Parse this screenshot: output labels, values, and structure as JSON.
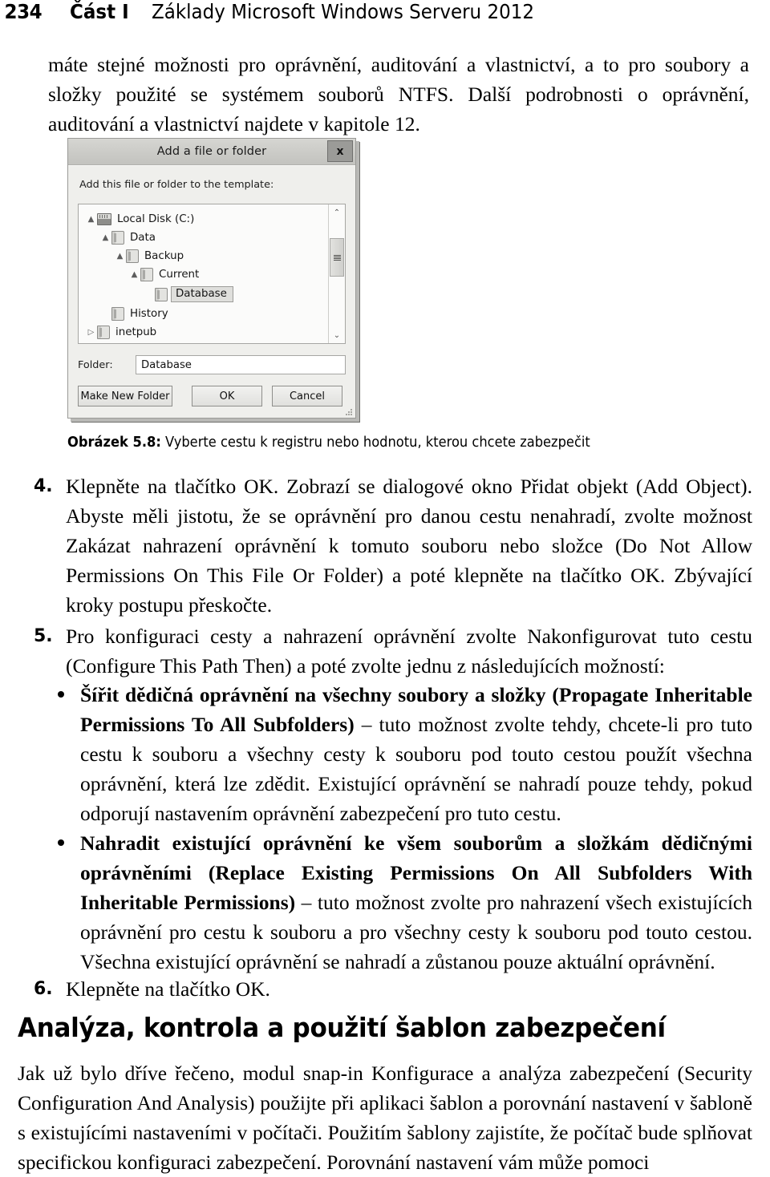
{
  "page": {
    "folio": "234",
    "part": "Část I",
    "book_title": "Základy Microsoft Windows Serveru 2012"
  },
  "intro_paragraph": "máte stejné možnosti pro oprávnění, auditování a vlastnictví, a to pro soubory a složky použité se systémem souborů NTFS. Další podrobnosti o oprávnění, auditování a vlastnictví najdete v kapitole 12.",
  "figure": {
    "caption_label": "Obrázek 5.8:",
    "caption_text": " Vyberte cestu k registru nebo hodnotu, kterou chcete zabezpečit",
    "dialog": {
      "title": "Add a file or folder",
      "close_label": "x",
      "prompt": "Add this file or folder to the template:",
      "tree": [
        {
          "indent": 0,
          "expander": "▲",
          "icon": "drive-icon",
          "label": "Local Disk (C:)",
          "selected": false
        },
        {
          "indent": 1,
          "expander": "▲",
          "icon": "folder-icon",
          "label": "Data",
          "selected": false
        },
        {
          "indent": 2,
          "expander": "▲",
          "icon": "folder-icon",
          "label": "Backup",
          "selected": false
        },
        {
          "indent": 3,
          "expander": "▲",
          "icon": "folder-icon",
          "label": "Current",
          "selected": false
        },
        {
          "indent": 4,
          "expander": "",
          "icon": "folder-icon",
          "label": "Database",
          "selected": true
        },
        {
          "indent": 1,
          "expander": "",
          "icon": "folder-icon",
          "label": "History",
          "selected": false
        },
        {
          "indent": 0,
          "expander": "▷",
          "icon": "folder-icon",
          "label": "inetpub",
          "selected": false
        }
      ],
      "scrollbar": {
        "up": "⌃",
        "down": "⌄"
      },
      "folder_field_label": "Folder:",
      "folder_field_value": "Database",
      "buttons": {
        "make_new_folder": "Make New Folder",
        "ok": "OK",
        "cancel": "Cancel"
      }
    }
  },
  "steps": [
    {
      "number": "4.",
      "text": "Klepněte na tlačítko OK. Zobrazí se dialogové okno Přidat objekt (Add Object). Abyste měli jistotu, že se oprávnění pro danou cestu nenahradí, zvolte možnost Zakázat nahrazení oprávnění k tomuto souboru nebo složce (Do Not Allow Permissions On This File Or Folder) a poté klepněte na tlačítko OK. Zbývající kroky postupu přeskočte."
    },
    {
      "number": "5.",
      "text": "Pro konfiguraci cesty a nahrazení oprávnění zvolte Nakonfigurovat tuto cestu (Configure This Path Then) a poté zvolte jednu z následujících možností:"
    },
    {
      "number": "6.",
      "text": "Klepněte na tlačítko OK."
    }
  ],
  "bullets": [
    {
      "bold": "Šířit dědičná oprávnění na všechny soubory a složky (Propagate Inheritable Permissions To All Subfolders)",
      "rest": " – tuto možnost zvolte tehdy, chcete-li pro tuto cestu k souboru a všechny cesty k souboru pod touto cestou použít všechna oprávnění, která lze zdědit. Existující oprávnění se nahradí pouze tehdy, pokud odporují nastavením oprávnění zabezpečení pro tuto cestu."
    },
    {
      "bold": "Nahradit existující oprávnění ke všem souborům a složkám dědičnými oprávněními (Replace Existing Permissions On All Subfolders With Inheritable Permissions)",
      "rest": " – tuto možnost zvolte pro nahrazení všech existujících oprávnění pro cestu k souboru a pro všechny cesty k souboru pod touto cestou. Všechna existující oprávnění se nahradí a zůstanou pouze aktuální oprávnění."
    }
  ],
  "section": {
    "heading": "Analýza, kontrola a použití šablon zabezpečení",
    "paragraph": "Jak už bylo dříve řečeno, modul snap-in Konfigurace a analýza zabezpečení (Security Configuration And Analysis) použijte při aplikaci šablon a porovnání nastavení v šabloně s existujícími nastaveními v počítači. Použitím šablony zajistíte, že počítač bude splňovat specifickou konfiguraci zabezpečení. Porovnání nastavení vám může pomoci"
  }
}
